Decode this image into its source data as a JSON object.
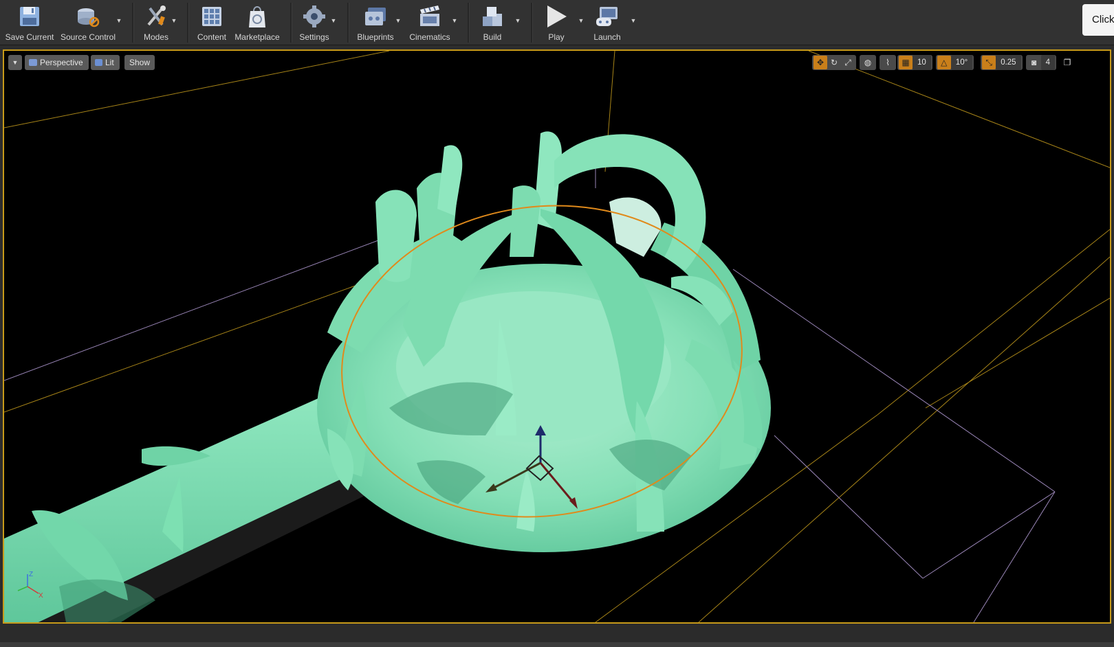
{
  "toolbar": {
    "save_current": "Save Current",
    "source_control": "Source Control",
    "modes": "Modes",
    "content": "Content",
    "marketplace": "Marketplace",
    "settings": "Settings",
    "blueprints": "Blueprints",
    "cinematics": "Cinematics",
    "build": "Build",
    "play": "Play",
    "launch": "Launch"
  },
  "tooltip": {
    "text": "Click"
  },
  "viewport": {
    "view_mode": "Perspective",
    "lighting": "Lit",
    "show": "Show",
    "grid_snap": "10",
    "rotation_snap": "10°",
    "scale_snap": "0.25",
    "camera_speed": "4"
  },
  "axis": {
    "z": "Z",
    "x": "X"
  },
  "colors": {
    "selection": "#c79a19",
    "mesh": "#7fe3b6",
    "accent_orange": "#e08a1b"
  }
}
